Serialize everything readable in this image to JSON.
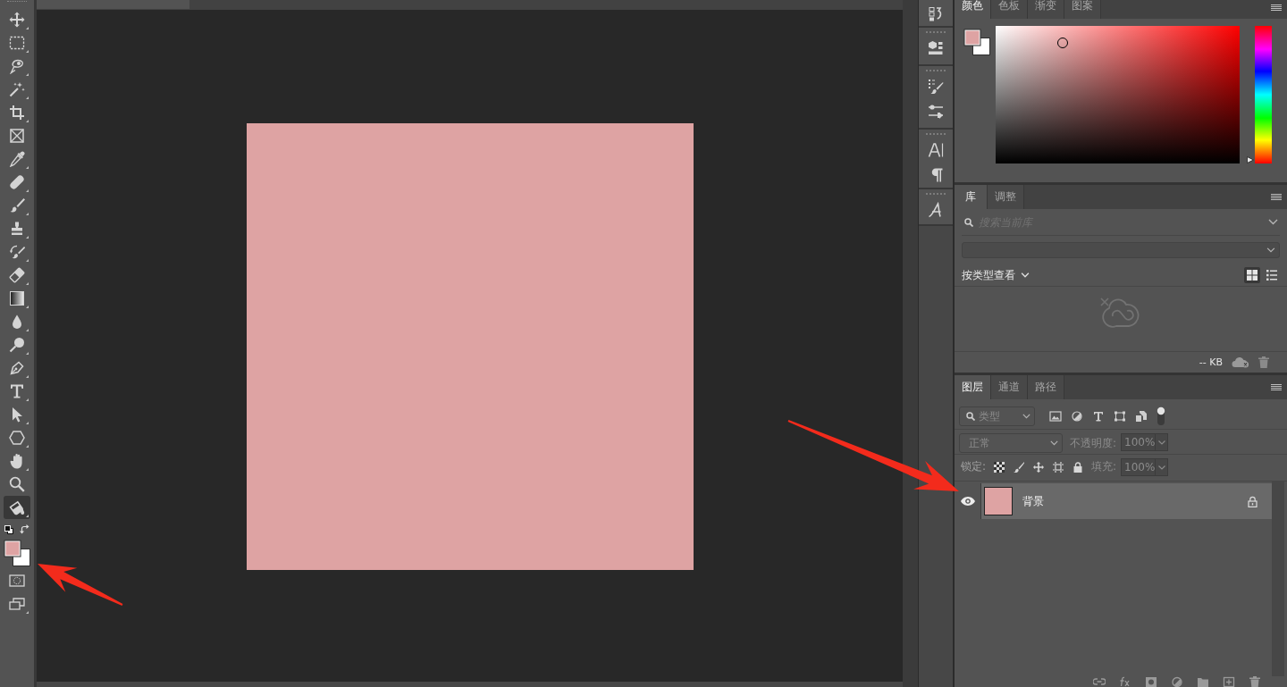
{
  "toolbar": {
    "tools": [
      {
        "selected": false
      },
      {
        "selected": false
      },
      {
        "selected": false
      },
      {
        "selected": false
      },
      {
        "selected": false
      },
      {
        "selected": false
      },
      {
        "selected": false
      },
      {
        "selected": false
      },
      {
        "selected": false
      },
      {
        "selected": false
      },
      {
        "selected": false
      },
      {
        "selected": false
      },
      {
        "selected": false
      },
      {
        "selected": false
      },
      {
        "selected": false
      },
      {
        "selected": false
      },
      {
        "selected": false
      },
      {
        "selected": false
      },
      {
        "selected": false
      },
      {
        "selected": false
      },
      {
        "selected": false
      },
      {
        "selected": true
      }
    ]
  },
  "color_panel": {
    "tabs": [
      {
        "label": "颜色",
        "selected": true
      },
      {
        "label": "色板",
        "selected": false
      },
      {
        "label": "渐变",
        "selected": false
      },
      {
        "label": "图案",
        "selected": false
      }
    ],
    "hue_slider": {
      "level": 0
    }
  },
  "library_panel": {
    "tabs": [
      {
        "label": "库",
        "selected": true
      },
      {
        "label": "调整",
        "selected": false
      }
    ],
    "search": {
      "placeholder": "搜索当前库"
    },
    "view_filter": "按类型查看",
    "view_modes": [
      {
        "selected": true
      },
      {
        "selected": false
      }
    ],
    "storage": "-- KB"
  },
  "layers_panel": {
    "tabs": [
      {
        "label": "图层",
        "selected": true
      },
      {
        "label": "通道",
        "selected": false
      },
      {
        "label": "路径",
        "selected": false
      }
    ],
    "filter_kind": "类型",
    "blend_mode": {
      "value": "正常",
      "disabled": true
    },
    "opacity": {
      "label": "不透明度:",
      "value": "100%",
      "disabled": true
    },
    "lock_label": "锁定:",
    "fill": {
      "label": "填充:",
      "value": "100%",
      "disabled": true
    },
    "layers": [
      {
        "name": "背景",
        "visible": true,
        "selected": true,
        "locked": true
      }
    ]
  }
}
